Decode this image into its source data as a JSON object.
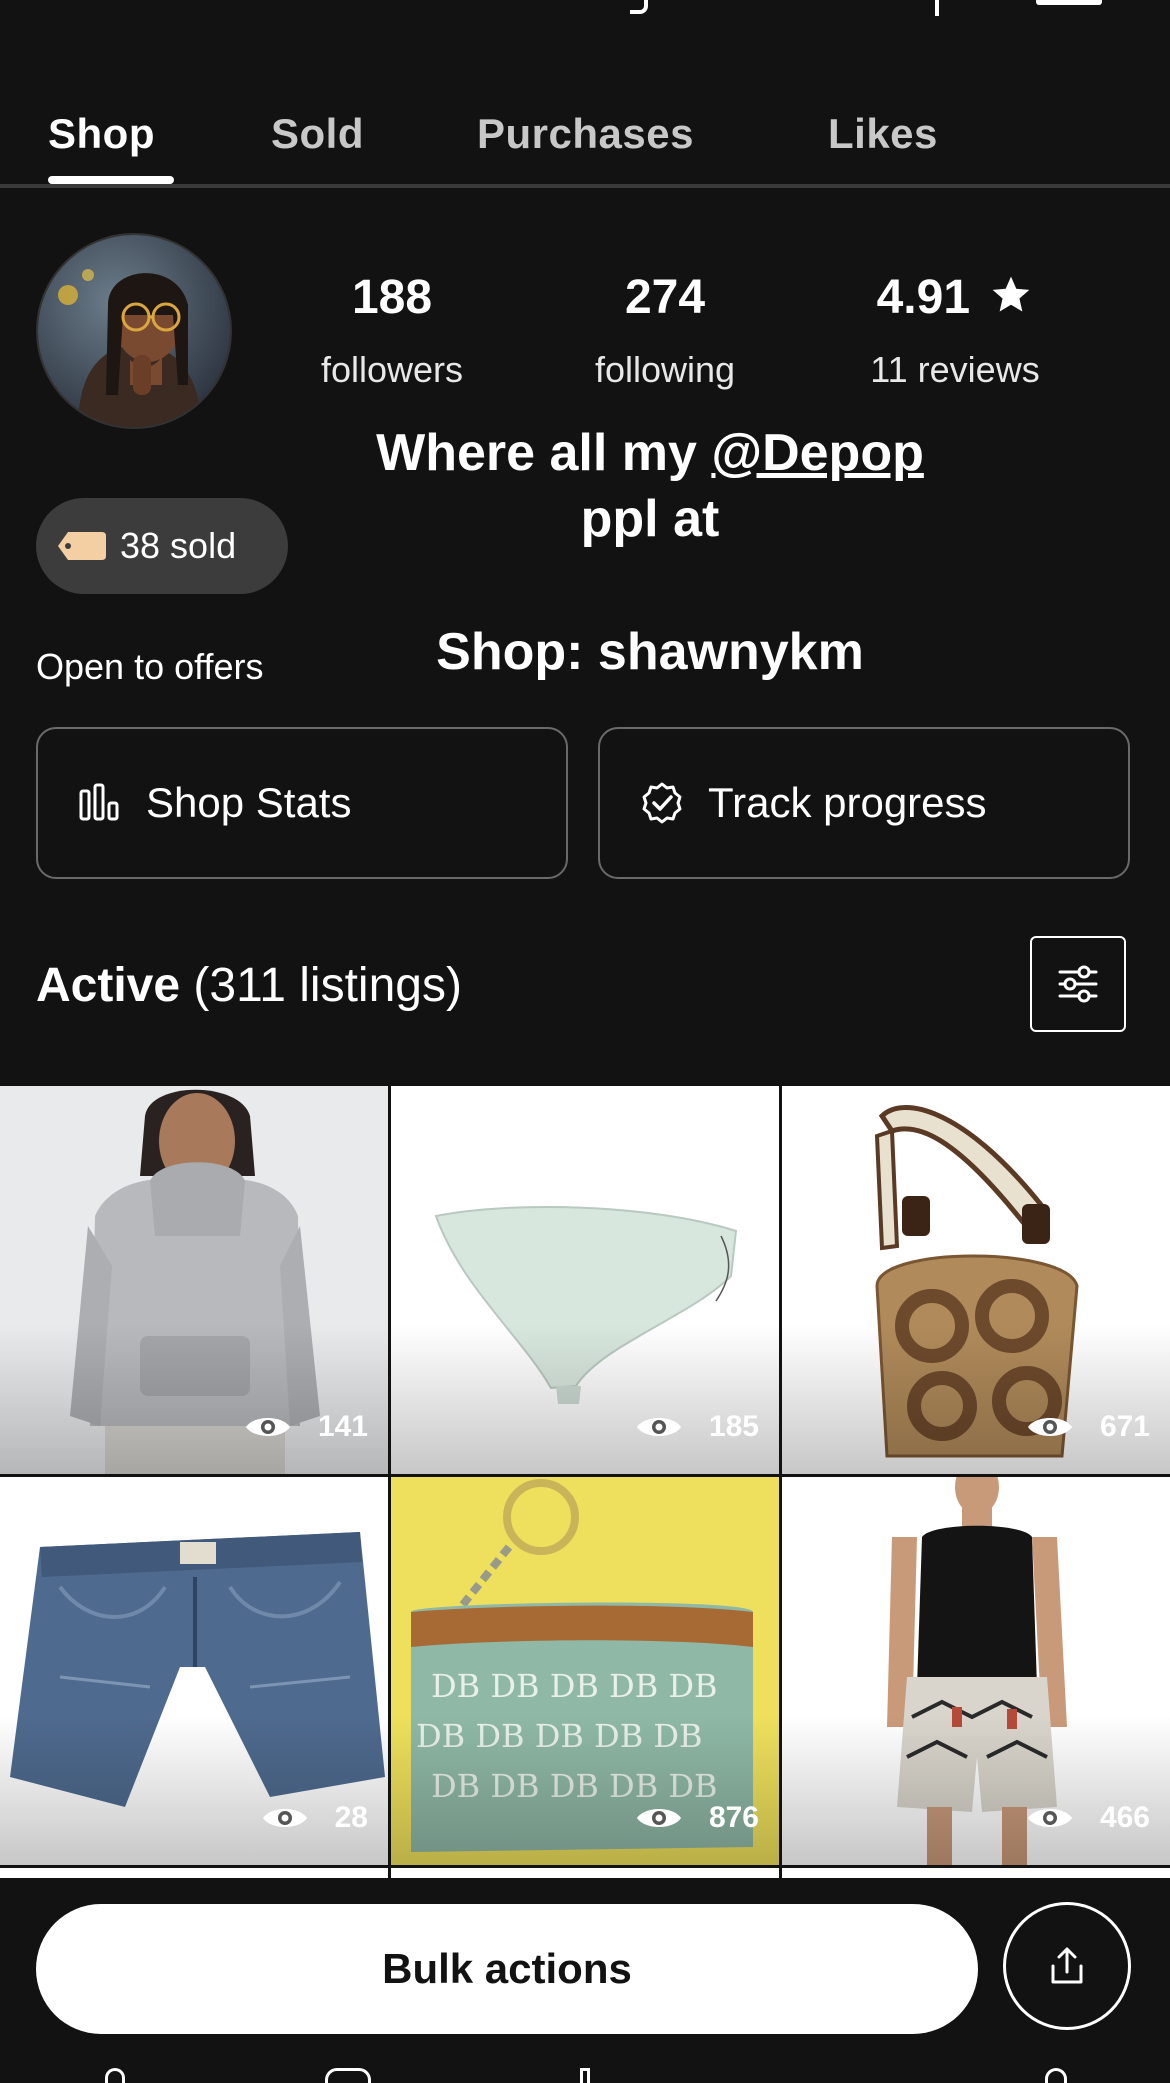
{
  "tabs": [
    {
      "label": "Shop"
    },
    {
      "label": "Sold"
    },
    {
      "label": "Purchases"
    },
    {
      "label": "Likes"
    }
  ],
  "profile": {
    "followers_count": "188",
    "followers_label": "followers",
    "following_count": "274",
    "following_label": "following",
    "rating": "4.91",
    "rating_icon": "star-icon",
    "reviews_label": "11 reviews",
    "bio_line1_prefix": "Where all my ",
    "bio_mention": "@Depop",
    "bio_line2": "ppl at",
    "sold_badge": "38 sold",
    "offers_text": "Open to offers",
    "shop_name": "Shop: shawnykm"
  },
  "actions": {
    "shop_stats": "Shop Stats",
    "track_progress": "Track progress"
  },
  "listings": {
    "title_bold": "Active",
    "title_rest": " (311 listings)",
    "items": [
      {
        "name": "grey hoodie",
        "views": "141"
      },
      {
        "name": "mint bikini bottom",
        "views": "185"
      },
      {
        "name": "coach print shoulder bag",
        "views": "671"
      },
      {
        "name": "denim shorts",
        "views": "28"
      },
      {
        "name": "green monogram coin purse",
        "views": "876"
      },
      {
        "name": "black tank and patterned shorts",
        "views": "466"
      }
    ]
  },
  "bottom": {
    "bulk_actions": "Bulk actions",
    "share_icon": "share-icon"
  },
  "colors": {
    "background": "#121212",
    "pill": "#3c3c3c",
    "tab_divider": "#3a3a3a"
  }
}
